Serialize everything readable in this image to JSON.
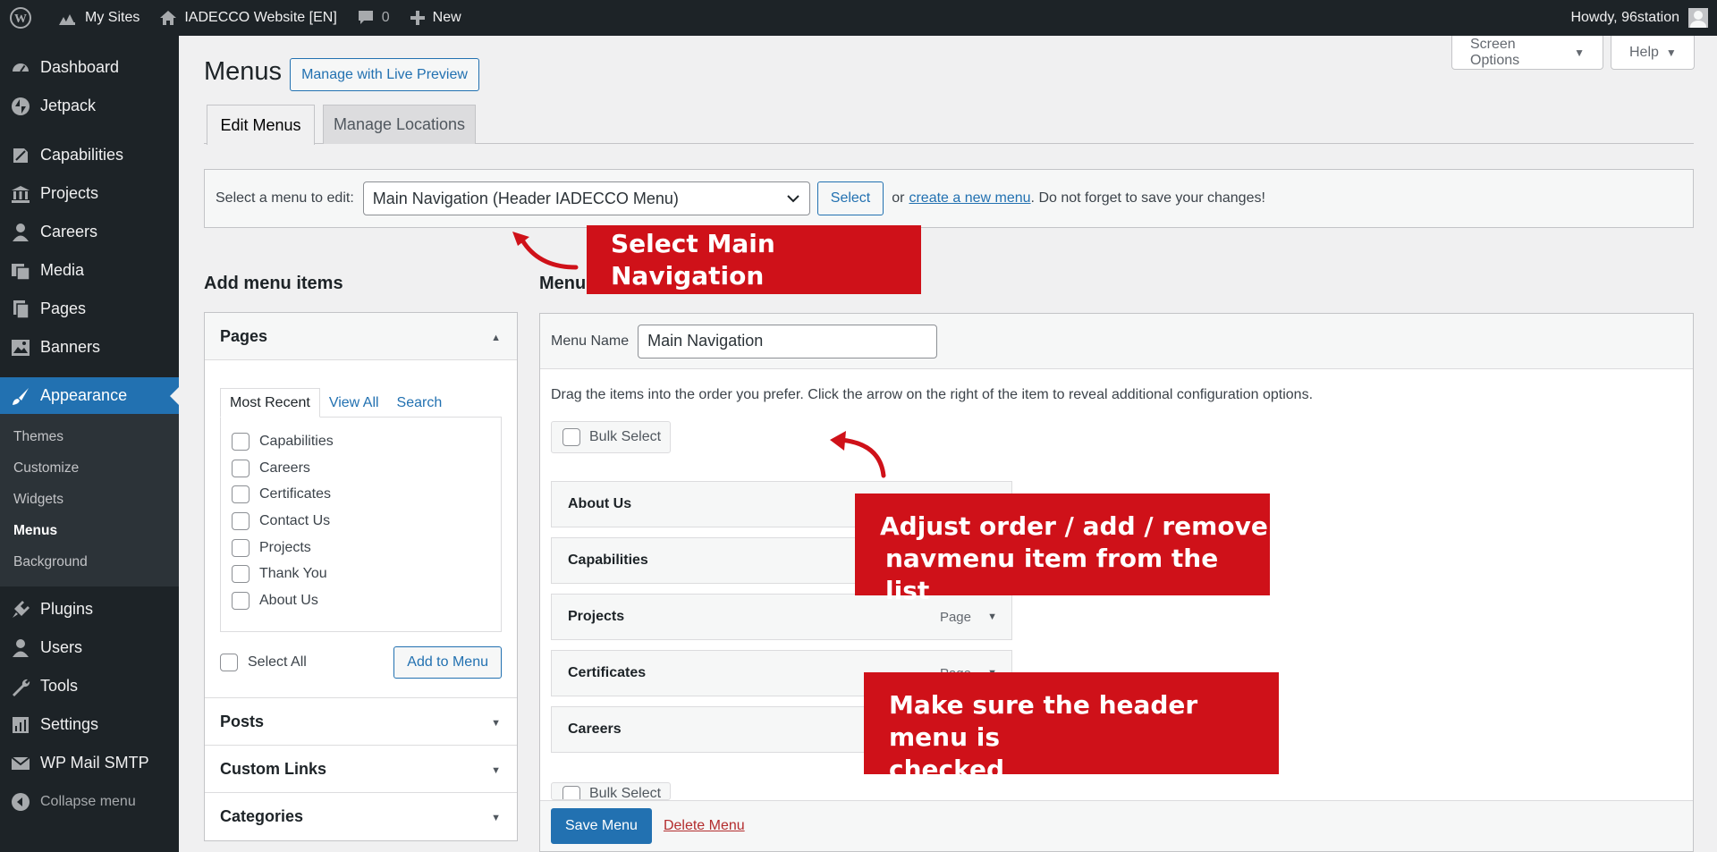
{
  "colors": {
    "admin_bar": "#1d2327",
    "accent": "#2271b1",
    "annotation": "#cf1119",
    "delete": "#b32d2e"
  },
  "adminbar": {
    "wp_icon": "wordpress-logo-icon",
    "my_sites": "My Sites",
    "site_name": "IADECCO Website [EN]",
    "comments_count": "0",
    "new_label": "New",
    "howdy": "Howdy, 96station"
  },
  "sidebar": {
    "items": [
      {
        "label": "Dashboard",
        "icon": "dashboard-icon"
      },
      {
        "label": "Jetpack",
        "icon": "jetpack-icon"
      },
      {
        "label": "Capabilities",
        "icon": "capabilities-icon"
      },
      {
        "label": "Projects",
        "icon": "projects-icon"
      },
      {
        "label": "Careers",
        "icon": "careers-icon"
      },
      {
        "label": "Media",
        "icon": "media-icon"
      },
      {
        "label": "Pages",
        "icon": "pages-icon"
      },
      {
        "label": "Banners",
        "icon": "banners-icon"
      },
      {
        "label": "Appearance",
        "icon": "appearance-icon"
      },
      {
        "label": "Plugins",
        "icon": "plugins-icon"
      },
      {
        "label": "Users",
        "icon": "users-icon"
      },
      {
        "label": "Tools",
        "icon": "tools-icon"
      },
      {
        "label": "Settings",
        "icon": "settings-icon"
      },
      {
        "label": "WP Mail SMTP",
        "icon": "mail-icon"
      }
    ],
    "submenu": [
      "Themes",
      "Customize",
      "Widgets",
      "Menus",
      "Background"
    ],
    "collapse": "Collapse menu"
  },
  "header": {
    "screen_options": "Screen Options",
    "help": "Help",
    "title": "Menus",
    "live_preview": "Manage with Live Preview",
    "tabs": [
      "Edit Menus",
      "Manage Locations"
    ]
  },
  "manage": {
    "label": "Select a menu to edit:",
    "selected_menu": "Main Navigation (Header IADECCO Menu)",
    "select_btn": "Select",
    "or_text": "or",
    "create_link": "create a new menu",
    "tail_text": ". Do not forget to save your changes!"
  },
  "add_items": {
    "title": "Add menu items",
    "pages_head": "Pages",
    "inner_tabs": [
      "Most Recent",
      "View All",
      "Search"
    ],
    "pages": [
      "Capabilities",
      "Careers",
      "Certificates",
      "Contact Us",
      "Projects",
      "Thank You",
      "About Us"
    ],
    "select_all": "Select All",
    "add_to_menu": "Add to Menu",
    "other_sections": [
      "Posts",
      "Custom Links",
      "Categories"
    ]
  },
  "menu_structure": {
    "title": "Menu",
    "name_label": "Menu Name",
    "name_value": "Main Navigation",
    "drag_hint": "Drag the items into the order you prefer. Click the arrow on the right of the item to reveal additional configuration options.",
    "bulk_select": "Bulk Select",
    "items": [
      {
        "title": "About Us",
        "type": ""
      },
      {
        "title": "Capabilities",
        "type": ""
      },
      {
        "title": "Projects",
        "type": "Page"
      },
      {
        "title": "Certificates",
        "type": "Page"
      },
      {
        "title": "Careers",
        "type": ""
      }
    ],
    "bulk_select_bottom": "Bulk Select",
    "save": "Save Menu",
    "delete": "Delete Menu"
  },
  "annotations": {
    "a1": "Select Main Navigation",
    "a2_line1": "Adjust order / add / remove",
    "a2_line2": "navmenu item from the list",
    "a3_line1": "Make sure the header menu is",
    "a3_line2": "checked"
  }
}
